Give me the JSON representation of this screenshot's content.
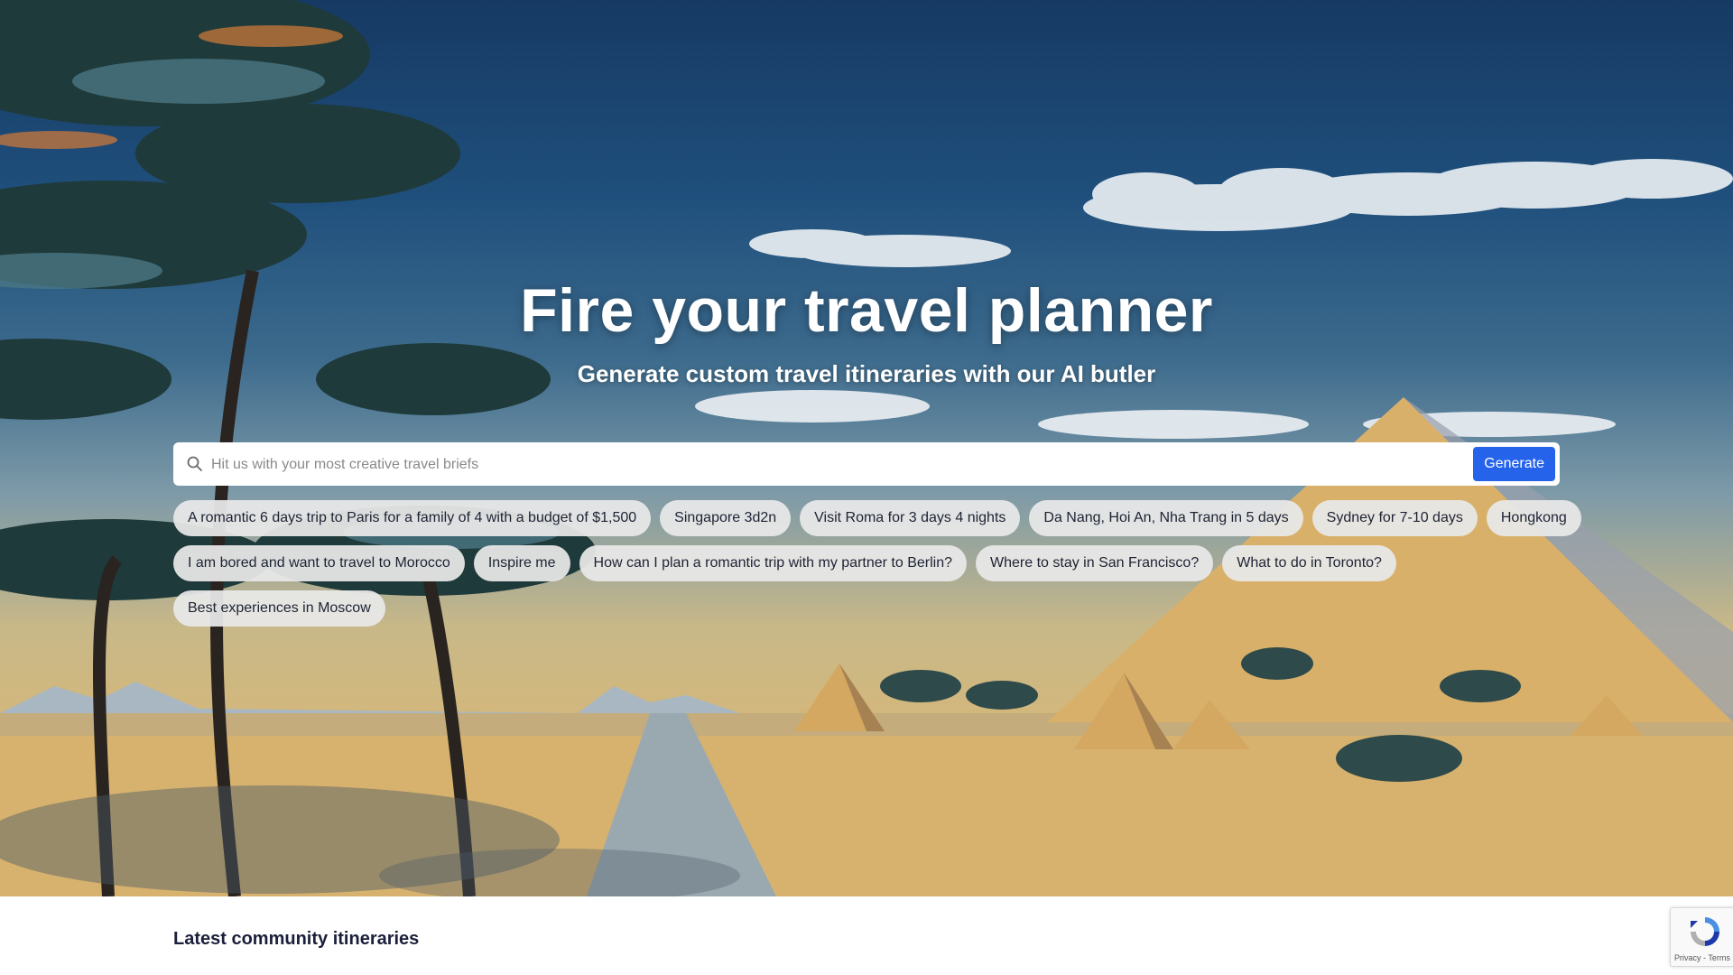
{
  "hero": {
    "title": "Fire your travel planner",
    "subtitle": "Generate custom travel itineraries with our AI butler"
  },
  "search": {
    "placeholder": "Hit us with your most creative travel briefs",
    "value": "",
    "icon": "search-icon",
    "button_label": "Generate",
    "button_color": "#2563eb"
  },
  "suggestions": [
    "A romantic 6 days trip to Paris for a family of 4 with a budget of $1,500",
    "Singapore 3d2n",
    "Visit Roma for 3 days 4 nights",
    "Da Nang, Hoi An, Nha Trang in 5 days",
    "Sydney for 7-10 days",
    "Hongkong",
    "I am bored and want to travel to Morocco",
    "Inspire me",
    "How can I plan a romantic trip with my partner to Berlin?",
    "Where to stay in San Francisco?",
    "What to do in Toronto?",
    "Best experiences in Moscow"
  ],
  "community": {
    "title": "Latest community itineraries"
  },
  "recaptcha": {
    "icon": "recaptcha-icon",
    "footer": "Privacy - Terms"
  }
}
